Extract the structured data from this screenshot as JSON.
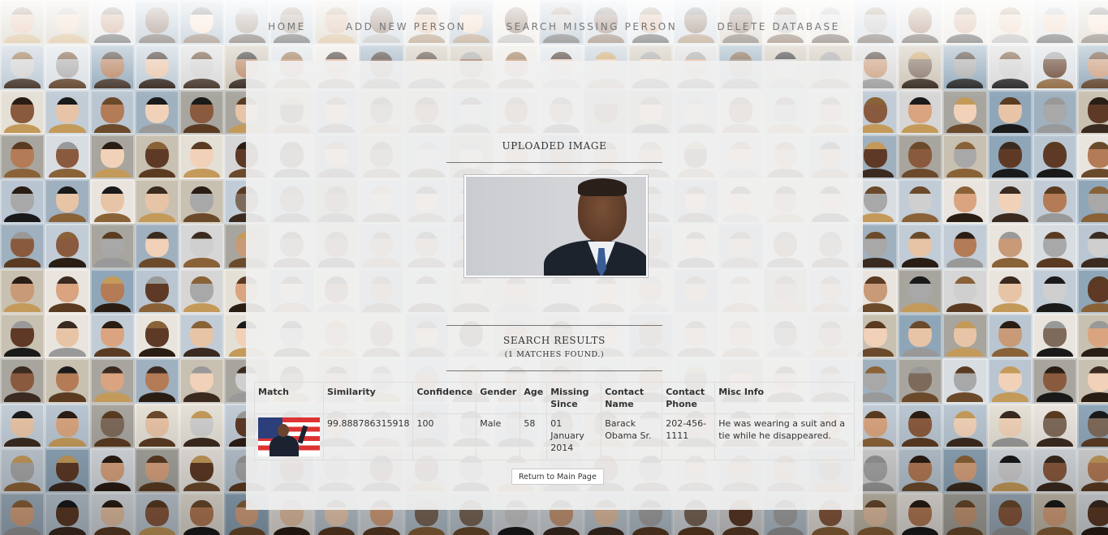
{
  "nav": {
    "items": [
      {
        "label": "HOME"
      },
      {
        "label": "ADD NEW PERSON"
      },
      {
        "label": "SEARCH MISSING PERSON"
      },
      {
        "label": "DELETE DATABASE"
      }
    ]
  },
  "uploaded": {
    "title": "UPLOADED IMAGE"
  },
  "results": {
    "title": "SEARCH RESULTS",
    "subtitle": "(1 MATCHES FOUND.)",
    "columns": [
      "Match",
      "Similarity",
      "Confidence",
      "Gender",
      "Age",
      "Missing Since",
      "Contact Name",
      "Contact Phone",
      "Misc Info"
    ],
    "rows": [
      {
        "similarity": "99.888786315918",
        "confidence": "100",
        "gender": "Male",
        "age": "58",
        "missing_since": "01 January 2014",
        "contact_name": "Barack Obama Sr.",
        "contact_phone": "202-456-1111",
        "misc_info": "He was wearing a suit and a tie while he disappeared."
      }
    ]
  },
  "actions": {
    "return_label": "Return to Main Page"
  },
  "colors": {
    "panel_bg": "#f0f0f0",
    "nav_text": "#777777",
    "rule": "#777777"
  }
}
